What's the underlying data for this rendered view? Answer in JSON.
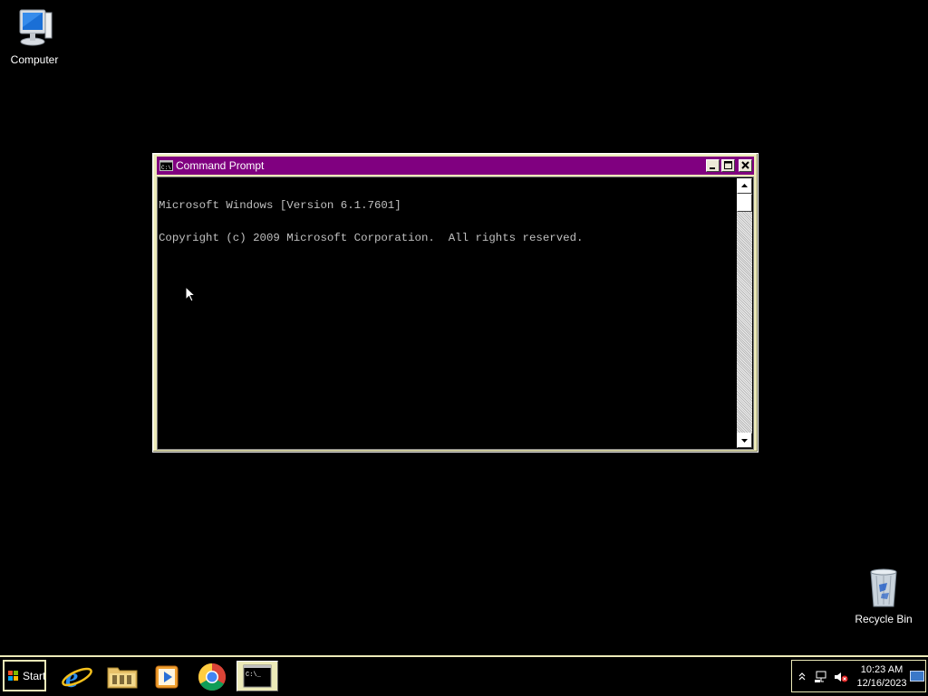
{
  "desktop": {
    "icons": [
      {
        "label": "Computer",
        "icon": "computer-icon"
      },
      {
        "label": "Recycle Bin",
        "icon": "recycle-bin-icon"
      }
    ]
  },
  "window": {
    "title": "Command Prompt",
    "app_icon": "console-icon",
    "colors": {
      "titlebar": "#800080",
      "frame": "#eceab8",
      "console_text": "#c0c0c0",
      "console_bg": "#000000"
    },
    "console_lines": [
      "Microsoft Windows [Version 6.1.7601]",
      "Copyright (c) 2009 Microsoft Corporation.  All rights reserved."
    ]
  },
  "taskbar": {
    "start_label": "Start",
    "apps": [
      {
        "name": "internet-explorer-icon",
        "active": false
      },
      {
        "name": "file-explorer-icon",
        "active": false
      },
      {
        "name": "media-player-icon",
        "active": false
      },
      {
        "name": "chrome-icon",
        "active": false
      },
      {
        "name": "command-prompt-icon",
        "active": true
      }
    ],
    "tray": {
      "time": "10:23 AM",
      "date": "12/16/2023"
    }
  }
}
